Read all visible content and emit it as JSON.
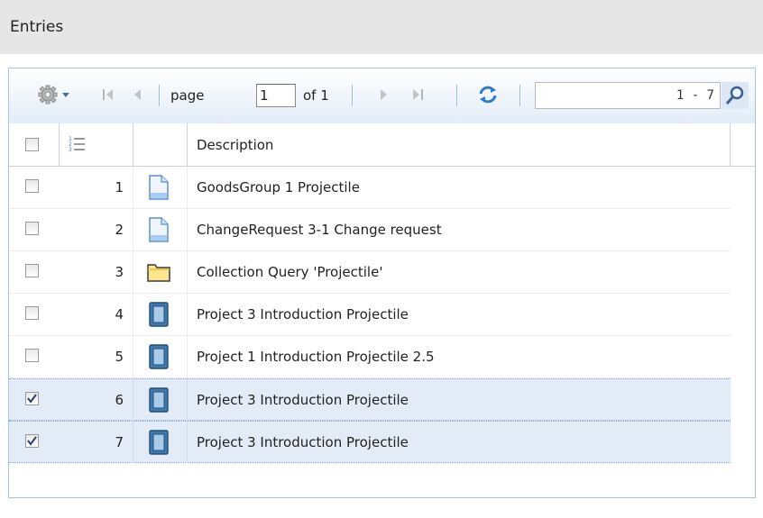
{
  "panel": {
    "title": "Entries"
  },
  "toolbar": {
    "settings_icon": "gear-icon",
    "first_icon": "first-page-icon",
    "prev_icon": "previous-page-icon",
    "page_label": "page",
    "page_value": "1",
    "of_label": "of 1",
    "next_icon": "next-page-icon",
    "last_icon": "last-page-icon",
    "refresh_icon": "refresh-icon",
    "range_text": "1 - 7",
    "search_icon": "search-icon"
  },
  "columns": {
    "select_all_checked": false,
    "rownum_icon": "row-numbers-icon",
    "description": "Description"
  },
  "rows": [
    {
      "num": "1",
      "icon": "document-icon",
      "description": "GoodsGroup 1 Projectile",
      "checked": false,
      "selected": false
    },
    {
      "num": "2",
      "icon": "document-icon",
      "description": "ChangeRequest 3-1 Change request",
      "checked": false,
      "selected": false
    },
    {
      "num": "3",
      "icon": "folder-icon",
      "description": "Collection Query 'Projectile'",
      "checked": false,
      "selected": false
    },
    {
      "num": "4",
      "icon": "book-icon",
      "description": "Project 3 Introduction Projectile",
      "checked": false,
      "selected": false
    },
    {
      "num": "5",
      "icon": "book-icon",
      "description": "Project 1 Introduction Projectile 2.5",
      "checked": false,
      "selected": false
    },
    {
      "num": "6",
      "icon": "book-icon",
      "description": "Project 3 Introduction Projectile",
      "checked": true,
      "selected": true
    },
    {
      "num": "7",
      "icon": "book-icon",
      "description": "Project 3 Introduction Projectile",
      "checked": true,
      "selected": true
    }
  ],
  "colors": {
    "accent": "#99bbe8",
    "selected_row": "#e3ebf6",
    "header": "#e6e6e6"
  }
}
